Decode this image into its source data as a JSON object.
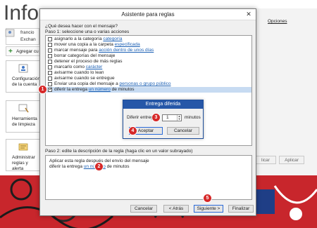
{
  "background": {
    "title": "Inform",
    "account_name": "francio",
    "account_sub": "Exchan",
    "add_account_label": "Agregar cu",
    "tiles": [
      {
        "line1": "Configuración",
        "line2": "de la cuenta"
      },
      {
        "line1": "Herramienta",
        "line2": "de limpieza"
      },
      {
        "line1": "Administrar",
        "line2": "reglas y alerta"
      }
    ],
    "options_link": "Opciones",
    "apply_partial": "licar",
    "apply_label": "Aplicar"
  },
  "dialog": {
    "title": "Asistente para reglas",
    "close_glyph": "✕",
    "question": "¿Qué desea hacer con el mensaje?",
    "step1_label": "Paso 1: seleccione una o varias acciones",
    "conditions": [
      {
        "text": "asignarlo a la categoría ",
        "link": "categoría",
        "checked": false
      },
      {
        "text": "mover una copia a la carpeta ",
        "link": "especificada",
        "checked": false
      },
      {
        "text": "marcar mensaje para ",
        "link": "acción dentro de unos días",
        "checked": false
      },
      {
        "text": "borrar categorías del mensaje",
        "link": "",
        "checked": false
      },
      {
        "text": "detener el proceso de más reglas",
        "link": "",
        "checked": false
      },
      {
        "text": "marcarlo como ",
        "link": "carácter",
        "checked": false
      },
      {
        "text": "avisarme cuando lo lean",
        "link": "",
        "checked": false
      },
      {
        "text": "avisarme cuando se entregue",
        "link": "",
        "checked": false
      },
      {
        "text": "Enviar una copia del mensaje a ",
        "link": "personas o grupo público",
        "checked": false
      },
      {
        "text": "diferir la entrega ",
        "link": "un número",
        "suffix": " de minutos",
        "checked": true
      }
    ],
    "step2_label": "Paso 2: edite la descripción de la regla (haga clic en un valor subrayado)",
    "description": {
      "line1": "Aplicar esta regla después del envío del mensaje",
      "line2_prefix": "diferir la entrega ",
      "line2_link": "un número",
      "line2_suffix": " de minutos"
    },
    "buttons": {
      "cancel": "Cancelar",
      "back": "< Atrás",
      "next": "Siguiente >",
      "finish": "Finalizar"
    }
  },
  "delay_dialog": {
    "title": "Entrega diferida",
    "label": "Diferir entrega",
    "value": "1",
    "unit": "minutos",
    "accept": "Aceptar",
    "cancel": "Cancelar"
  },
  "callouts": [
    "1",
    "2",
    "3",
    "4",
    "5"
  ],
  "colors": {
    "badge": "#d62828",
    "link": "#1a5fb4",
    "selection": "#c7dbf2",
    "subdialog_title": "#2657a8",
    "bottom_banner": "#c8262c"
  }
}
